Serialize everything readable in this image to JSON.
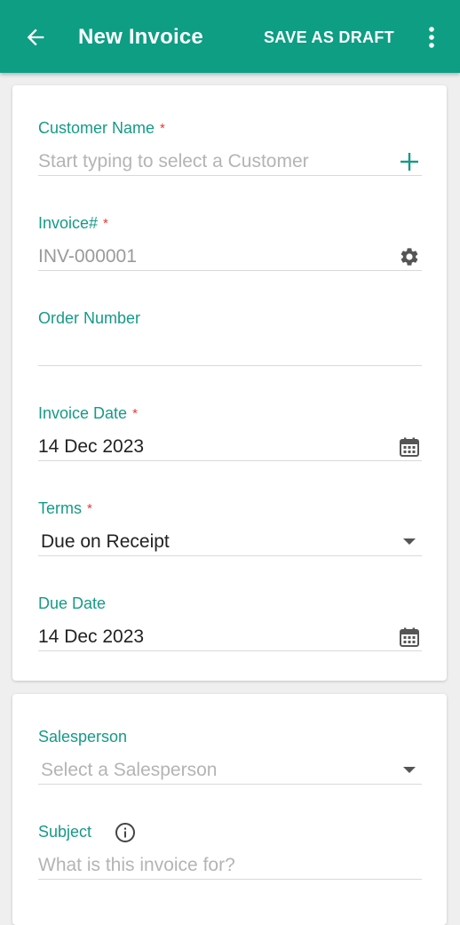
{
  "appbar": {
    "title": "New Invoice",
    "save_draft_label": "SAVE AS DRAFT",
    "color": "#0d9e84"
  },
  "form": {
    "customer": {
      "label": "Customer Name",
      "required_mark": "*",
      "placeholder": "Start typing to select a Customer",
      "action_icon": "plus-icon"
    },
    "invoice_number": {
      "label": "Invoice#",
      "required_mark": "*",
      "value": "INV-000001",
      "action_icon": "gear-icon"
    },
    "order_number": {
      "label": "Order Number",
      "value": ""
    },
    "invoice_date": {
      "label": "Invoice Date",
      "required_mark": "*",
      "value": "14 Dec 2023",
      "action_icon": "calendar-icon"
    },
    "terms": {
      "label": "Terms",
      "required_mark": "*",
      "value": "Due on Receipt",
      "action_icon": "dropdown-arrow-icon"
    },
    "due_date": {
      "label": "Due Date",
      "value": "14 Dec 2023",
      "action_icon": "calendar-icon"
    },
    "salesperson": {
      "label": "Salesperson",
      "placeholder": "Select a Salesperson",
      "action_icon": "dropdown-arrow-icon"
    },
    "subject": {
      "label": "Subject",
      "placeholder": "What is this invoice for?",
      "info_icon": "info-icon"
    }
  },
  "colors": {
    "label": "#169a86",
    "required": "#e53935",
    "placeholder": "#b4b4b4"
  }
}
